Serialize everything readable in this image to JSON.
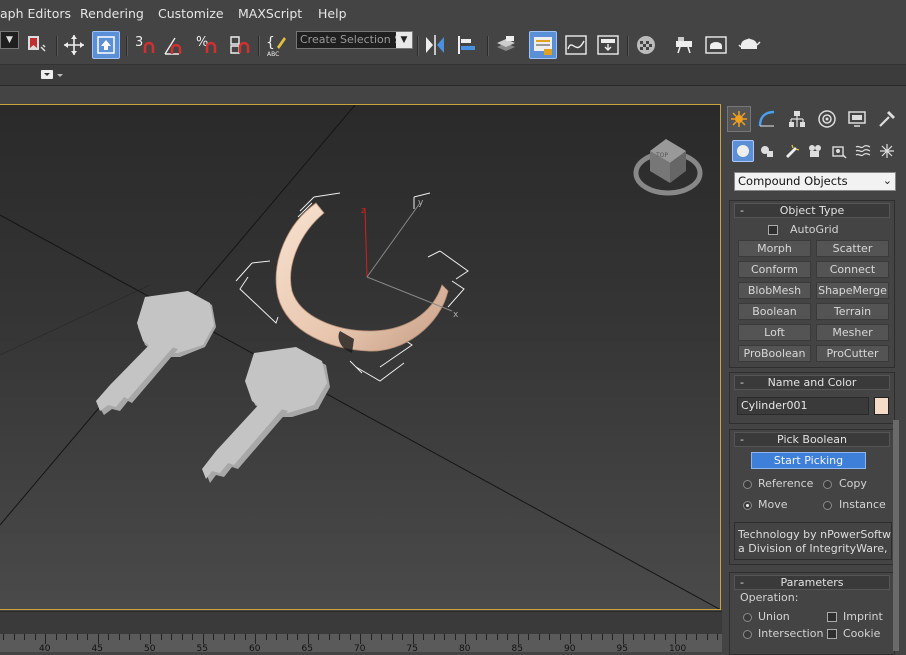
{
  "menu": {
    "items": [
      "aph Editors",
      "Rendering",
      "Customize",
      "MAXScript",
      "Help"
    ]
  },
  "toolbar": {
    "selection_set_placeholder": "Create Selection Se",
    "snap_toggle_label": "3",
    "percent_snap_label": "%"
  },
  "command_panel": {
    "category_dropdown": "Compound Objects",
    "object_type": {
      "title": "Object Type",
      "autogrid_label": "AutoGrid",
      "buttons": [
        "Morph",
        "Scatter",
        "Conform",
        "Connect",
        "BlobMesh",
        "ShapeMerge",
        "Boolean",
        "Terrain",
        "Loft",
        "Mesher",
        "ProBoolean",
        "ProCutter"
      ]
    },
    "name_and_color": {
      "title": "Name and Color",
      "object_name": "Cylinder001",
      "object_color": "#f5dcc8"
    },
    "pick_boolean": {
      "title": "Pick Boolean",
      "start_picking_label": "Start Picking",
      "options": [
        "Reference",
        "Copy",
        "Move",
        "Instance"
      ],
      "selected_option": "Move",
      "info_line1": "Technology by nPowerSoftware",
      "info_line2": "a Division of IntegrityWare,"
    },
    "parameters": {
      "title": "Parameters",
      "operation_label": "Operation:",
      "operations": [
        "Union",
        "Intersection"
      ],
      "options": [
        "Imprint",
        "Cookie"
      ]
    }
  },
  "viewport": {
    "gizmo_labels": {
      "z": "z",
      "y": "y",
      "x": "x"
    },
    "viewcube_label": "TOP"
  },
  "timeline": {
    "ticks": [
      "40",
      "45",
      "50",
      "55",
      "60",
      "65",
      "70",
      "75",
      "80",
      "85",
      "90",
      "95",
      "100"
    ]
  },
  "colors": {
    "accent": "#5b8fd6",
    "viewport_border": "#c8a53a",
    "ring": "#e8c8b0"
  }
}
